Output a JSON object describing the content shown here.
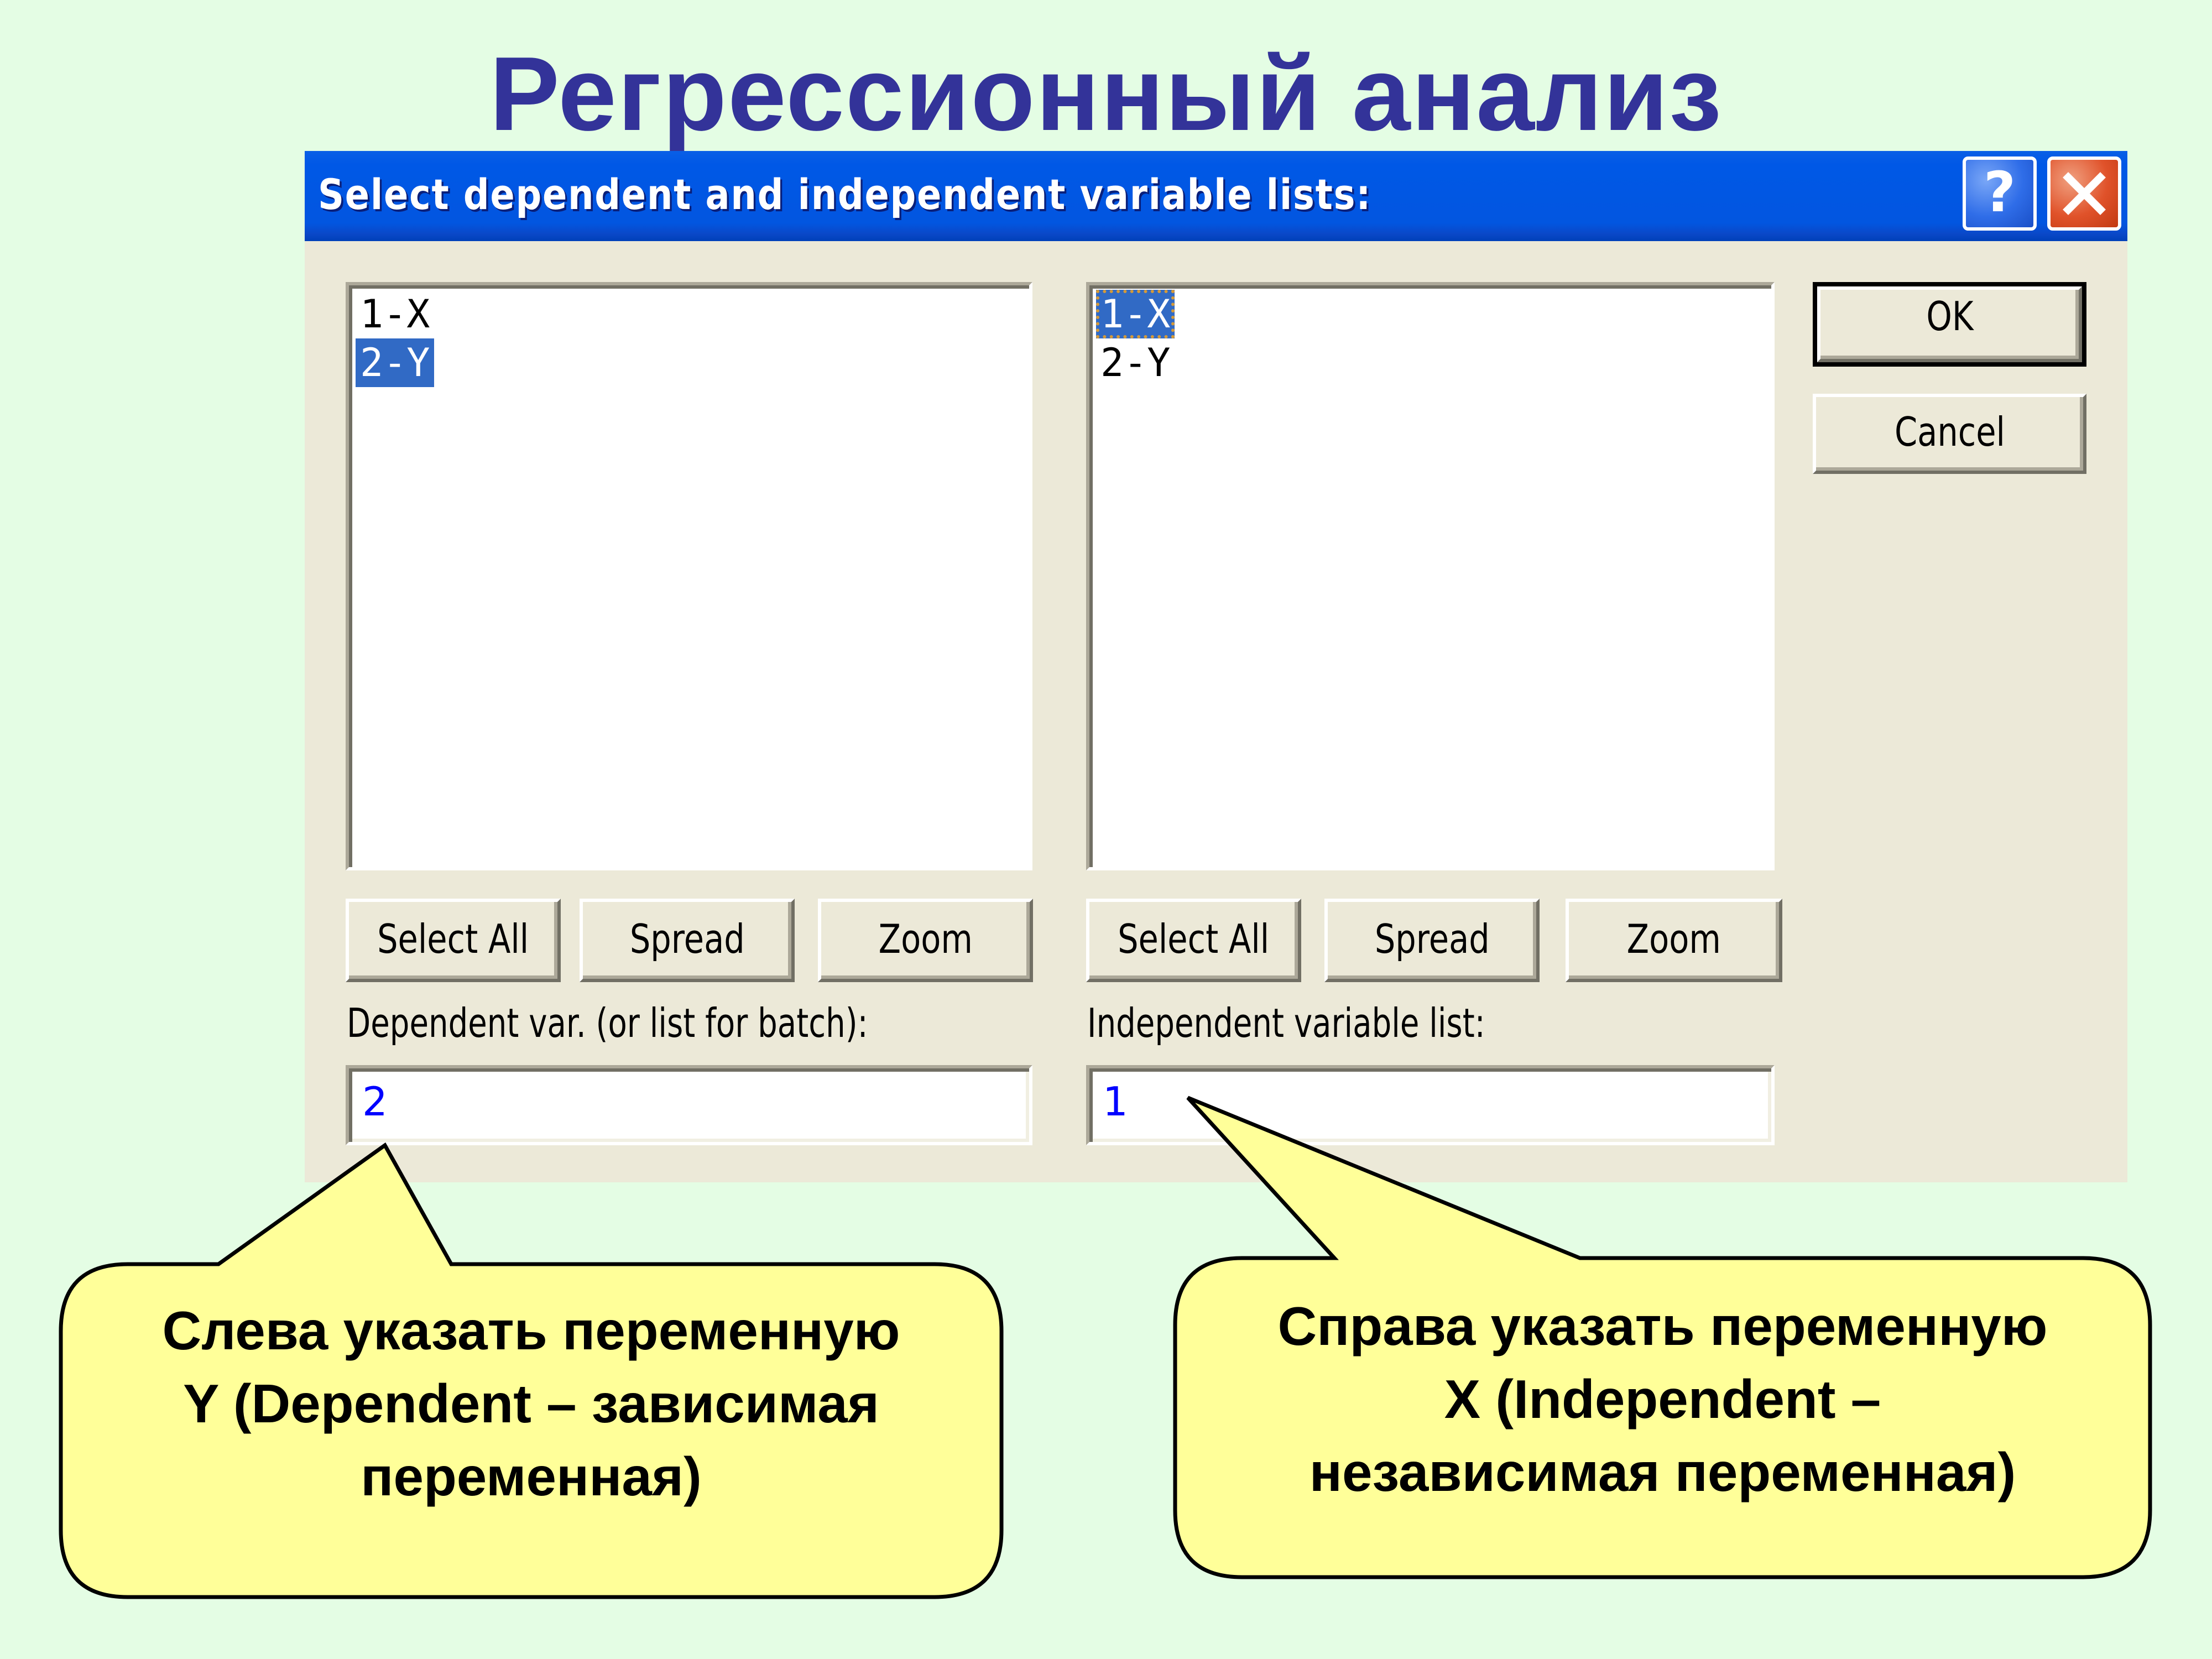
{
  "slide": {
    "title": "Регрессионный анализ"
  },
  "dialog": {
    "title": "Select dependent and independent variable lists:",
    "help_icon": "?",
    "close_icon": "close-x",
    "left_list": {
      "items": [
        {
          "label": "1-X",
          "selected": false
        },
        {
          "label": "2-Y",
          "selected": true
        }
      ],
      "buttons": [
        "Select All",
        "Spread",
        "Zoom"
      ],
      "field_label": "Dependent var. (or list for batch):",
      "field_value": "2"
    },
    "right_list": {
      "items": [
        {
          "label": "1-X",
          "selected": true,
          "focused": true
        },
        {
          "label": "2-Y",
          "selected": false
        }
      ],
      "buttons": [
        "Select All",
        "Spread",
        "Zoom"
      ],
      "field_label": "Independent variable list:",
      "field_value": "1"
    },
    "ok_label": "OK",
    "cancel_label": "Cancel"
  },
  "callouts": {
    "left": {
      "lines": [
        "Слева указать переменную",
        "Y (Dependent – зависимая",
        "переменная)"
      ]
    },
    "right": {
      "lines": [
        "Справа указать переменную",
        "X (Independent –",
        "независимая переменная)"
      ]
    }
  },
  "colors": {
    "background": "#e4fde4",
    "title": "#333399",
    "titlebar": "#0058e6",
    "selection": "#316ac5",
    "callout_fill": "#ffff99",
    "field_text": "#0000ff"
  }
}
